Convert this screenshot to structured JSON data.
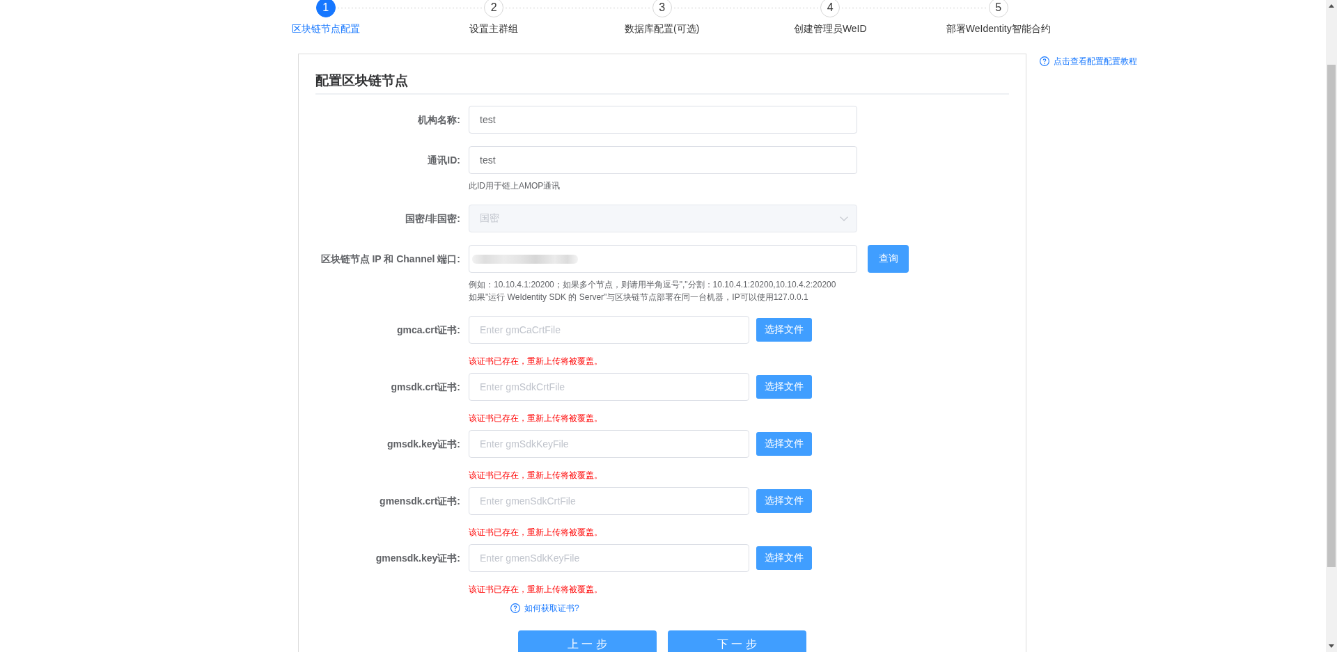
{
  "steps": [
    {
      "number": "1",
      "label": "区块链节点配置",
      "selected": true
    },
    {
      "number": "2",
      "label": "设置主群组",
      "selected": false
    },
    {
      "number": "3",
      "label": "数据库配置(可选)",
      "selected": false
    },
    {
      "number": "4",
      "label": "创建管理员WeID",
      "selected": false
    },
    {
      "number": "5",
      "label": "部署WeIdentity智能合约",
      "selected": false
    }
  ],
  "tutorial_link": {
    "label": "点击查看配置配置教程"
  },
  "form": {
    "title": "配置区块链节点",
    "fields": [
      {
        "kind": "text",
        "label": "机构名称:",
        "value": "test"
      },
      {
        "kind": "text",
        "label": "通讯ID:",
        "value": "test",
        "hints": [
          "此ID用于链上AMOP通讯"
        ]
      },
      {
        "kind": "select",
        "label": "国密/非国密:",
        "value": "国密",
        "disabled": true
      },
      {
        "kind": "text-button",
        "label": "区块链节点 IP 和 Channel 端口:",
        "value_blurred": true,
        "button": "查询",
        "hints": [
          "例如：10.10.4.1:20200；如果多个节点，则请用半角逗号\",\"分割：10.10.4.1:20200,10.10.4.2:20200",
          "如果\"运行 WeIdentity SDK 的 Server\"与区块链节点部署在同一台机器，IP可以使用127.0.0.1"
        ]
      },
      {
        "kind": "file",
        "label": "gmca.crt证书:",
        "placeholder": "Enter gmCaCrtFile",
        "button": "选择文件",
        "error": "该证书已存在，重新上传将被覆盖。"
      },
      {
        "kind": "file",
        "label": "gmsdk.crt证书:",
        "placeholder": "Enter gmSdkCrtFile",
        "button": "选择文件",
        "error": "该证书已存在，重新上传将被覆盖。"
      },
      {
        "kind": "file",
        "label": "gmsdk.key证书:",
        "placeholder": "Enter gmSdkKeyFile",
        "button": "选择文件",
        "error": "该证书已存在，重新上传将被覆盖。"
      },
      {
        "kind": "file",
        "label": "gmensdk.crt证书:",
        "placeholder": "Enter gmenSdkCrtFile",
        "button": "选择文件",
        "error": "该证书已存在，重新上传将被覆盖。"
      },
      {
        "kind": "file",
        "label": "gmensdk.key证书:",
        "placeholder": "Enter gmenSdkKeyFile",
        "button": "选择文件",
        "error": "该证书已存在，重新上传将被覆盖。"
      }
    ],
    "cert_help_link": "如何获取证书?",
    "buttons": [
      "上 一 步",
      "下 一 步"
    ]
  }
}
